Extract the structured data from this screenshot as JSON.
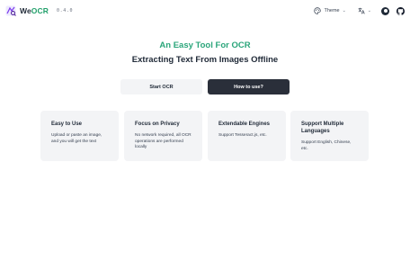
{
  "header": {
    "brand_prefix": "We",
    "brand_suffix": "OCR",
    "version": "0.4.0",
    "theme_label": "Theme",
    "theme_chevron": "⌄",
    "lang_chevron": "⌄",
    "icons": [
      "logo-icon",
      "palette-icon",
      "translate-icon",
      "user-icon",
      "github-icon"
    ]
  },
  "hero": {
    "title": "An Easy Tool For OCR",
    "subtitle": "Extracting Text From Images Offline"
  },
  "actions": {
    "start_label": "Start OCR",
    "how_label": "How to use?"
  },
  "features": [
    {
      "title": "Easy to Use",
      "desc": "Upload or paste an image, and you will get the text"
    },
    {
      "title": "Focus on Privacy",
      "desc": "No network required, all OCR operations are performed locally"
    },
    {
      "title": "Extendable Engines",
      "desc": "Support Tesseract.js, etc."
    },
    {
      "title": "Support Multiple Languages",
      "desc": "Support English, Chinese, etc."
    }
  ],
  "colors": {
    "accent_green": "#2aa57a",
    "dark_button": "#2a2f3a",
    "card_bg": "#f3f4f6"
  }
}
